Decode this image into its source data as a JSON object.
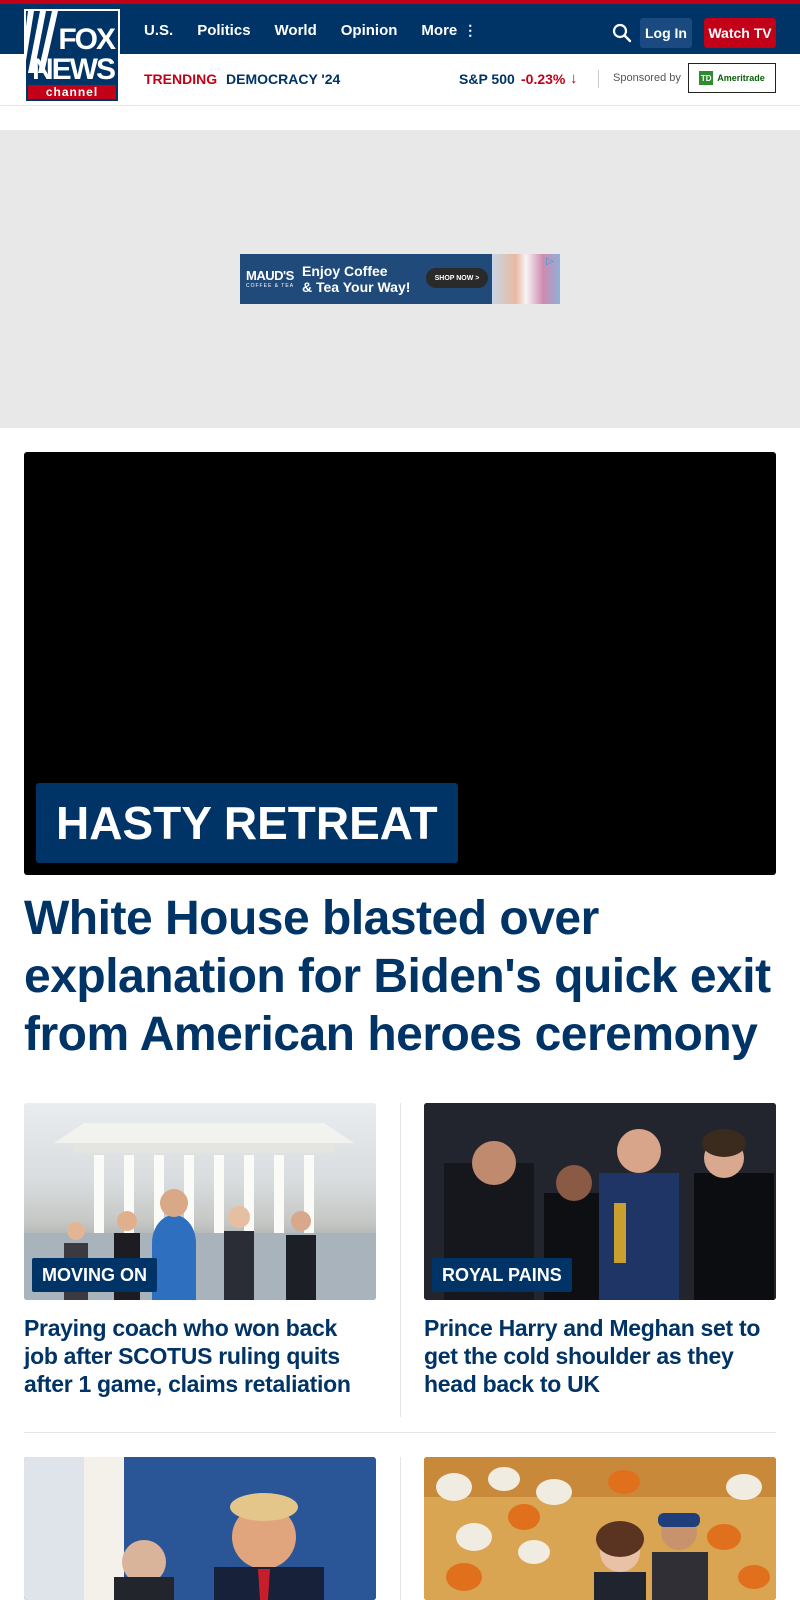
{
  "brand": {
    "line1": "FOX",
    "line2": "NEWS",
    "line3": "channel"
  },
  "nav": {
    "items": [
      "U.S.",
      "Politics",
      "World",
      "Opinion"
    ],
    "more_label": "More",
    "login_label": "Log In",
    "watch_label": "Watch TV"
  },
  "subbar": {
    "trending_label": "TRENDING",
    "trending_topic": "DEMOCRACY '24",
    "index_name": "S&P 500",
    "index_change": "-0.23%",
    "index_direction_icon": "arrow-down-icon",
    "sponsored_label": "Sponsored by",
    "sponsor_logo_mark": "TD",
    "sponsor_name": "Ameritrade"
  },
  "ad": {
    "brand": "MAUD'S",
    "brand_tagline": "COFFEE & TEA",
    "line1": "Enjoy Coffee",
    "line2": "& Tea Your Way!",
    "cta": "SHOP NOW >"
  },
  "hero": {
    "tag": "HASTY RETREAT",
    "title": "White House blasted over explanation for Biden's quick exit from American heroes ceremony"
  },
  "cards": [
    {
      "tag": "MOVING ON",
      "title": "Praying coach who won back job after SCOTUS ruling quits after 1 game, claims retaliation"
    },
    {
      "tag": "ROYAL PAINS",
      "title": "Prince Harry and Meghan set to get the cold shoulder as they head back to UK"
    }
  ],
  "colors": {
    "brand_navy": "#003366",
    "accent_red": "#c20017",
    "ad_background": "#e8e8e8"
  }
}
